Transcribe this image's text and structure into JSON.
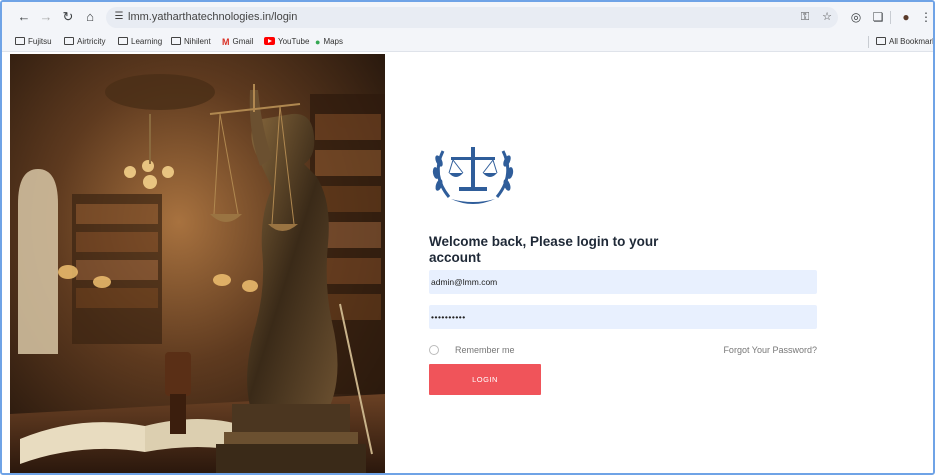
{
  "browser": {
    "url": "lmm.yatharthatechnologies.in/login",
    "bookmarks": [
      {
        "label": "Fujitsu",
        "icon": "folder-icon"
      },
      {
        "label": "Airtricity",
        "icon": "folder-icon"
      },
      {
        "label": "Learning",
        "icon": "folder-icon"
      },
      {
        "label": "Nihilent",
        "icon": "folder-icon"
      },
      {
        "label": "Gmail",
        "icon": "gmail-icon"
      },
      {
        "label": "YouTube",
        "icon": "youtube-icon"
      },
      {
        "label": "Maps",
        "icon": "maps-icon"
      }
    ],
    "all_bookmarks": "All Bookmarks"
  },
  "login": {
    "heading": "Welcome back, Please login to your account",
    "email_value": "admin@lmm.com",
    "password_value": "••••••••••",
    "remember_label": "Remember me",
    "forgot_label": "Forgot Your Password?",
    "login_button": "LOGIN"
  },
  "colors": {
    "accent": "#f0545a",
    "input_bg": "#e8f0fe",
    "logo_blue": "#2f5d9a"
  }
}
